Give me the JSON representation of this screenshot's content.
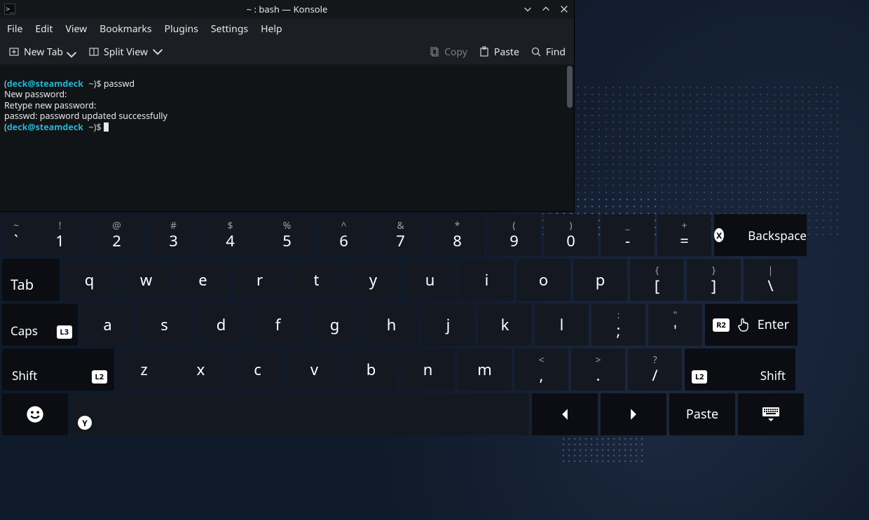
{
  "window": {
    "title": "~ : bash — Konsole",
    "icon_glyph": ">_"
  },
  "menu": {
    "file": "File",
    "edit": "Edit",
    "view": "View",
    "bookmarks": "Bookmarks",
    "plugins": "Plugins",
    "settings": "Settings",
    "help": "Help"
  },
  "toolbar": {
    "new_tab": "New Tab",
    "split_view": "Split View",
    "copy": "Copy",
    "paste": "Paste",
    "find": "Find"
  },
  "terminal": {
    "user": "deck",
    "host": "steamdeck",
    "path": "~",
    "command": "passwd",
    "line_new": "New password:",
    "line_retype": "Retype new password:",
    "line_success": "passwd: password updated successfully"
  },
  "osk": {
    "row1": [
      {
        "sub": "~",
        "main": "`"
      },
      {
        "sub": "!",
        "main": "1"
      },
      {
        "sub": "@",
        "main": "2"
      },
      {
        "sub": "#",
        "main": "3"
      },
      {
        "sub": "$",
        "main": "4"
      },
      {
        "sub": "%",
        "main": "5"
      },
      {
        "sub": "^",
        "main": "6"
      },
      {
        "sub": "&",
        "main": "7"
      },
      {
        "sub": "*",
        "main": "8"
      },
      {
        "sub": "(",
        "main": "9"
      },
      {
        "sub": ")",
        "main": "0"
      },
      {
        "sub": "_",
        "main": "-"
      },
      {
        "sub": "+",
        "main": "="
      }
    ],
    "backspace": "Backspace",
    "backspace_badge": "X",
    "tab": "Tab",
    "row2": [
      "q",
      "w",
      "e",
      "r",
      "t",
      "y",
      "u",
      "i",
      "o",
      "p"
    ],
    "row2_tail": [
      {
        "sub": "{",
        "main": "["
      },
      {
        "sub": "}",
        "main": "]"
      },
      {
        "sub": "|",
        "main": "\\"
      }
    ],
    "caps": "Caps",
    "caps_badge": "L3",
    "row3": [
      "a",
      "s",
      "d",
      "f",
      "g",
      "h",
      "j",
      "k",
      "l"
    ],
    "row3_tail": [
      {
        "sub": ":",
        "main": ";"
      },
      {
        "sub": "\"",
        "main": "'"
      }
    ],
    "enter": "Enter",
    "enter_badge": "R2",
    "shift_l": "Shift",
    "shift_l_badge": "L2",
    "row4": [
      "z",
      "x",
      "c",
      "v",
      "b",
      "n",
      "m"
    ],
    "row4_tail": [
      {
        "sub": "<",
        "main": ","
      },
      {
        "sub": ">",
        "main": "."
      },
      {
        "sub": "?",
        "main": "/"
      }
    ],
    "shift_r": "Shift",
    "shift_r_badge": "L2",
    "space_badge": "Y",
    "paste": "Paste"
  }
}
